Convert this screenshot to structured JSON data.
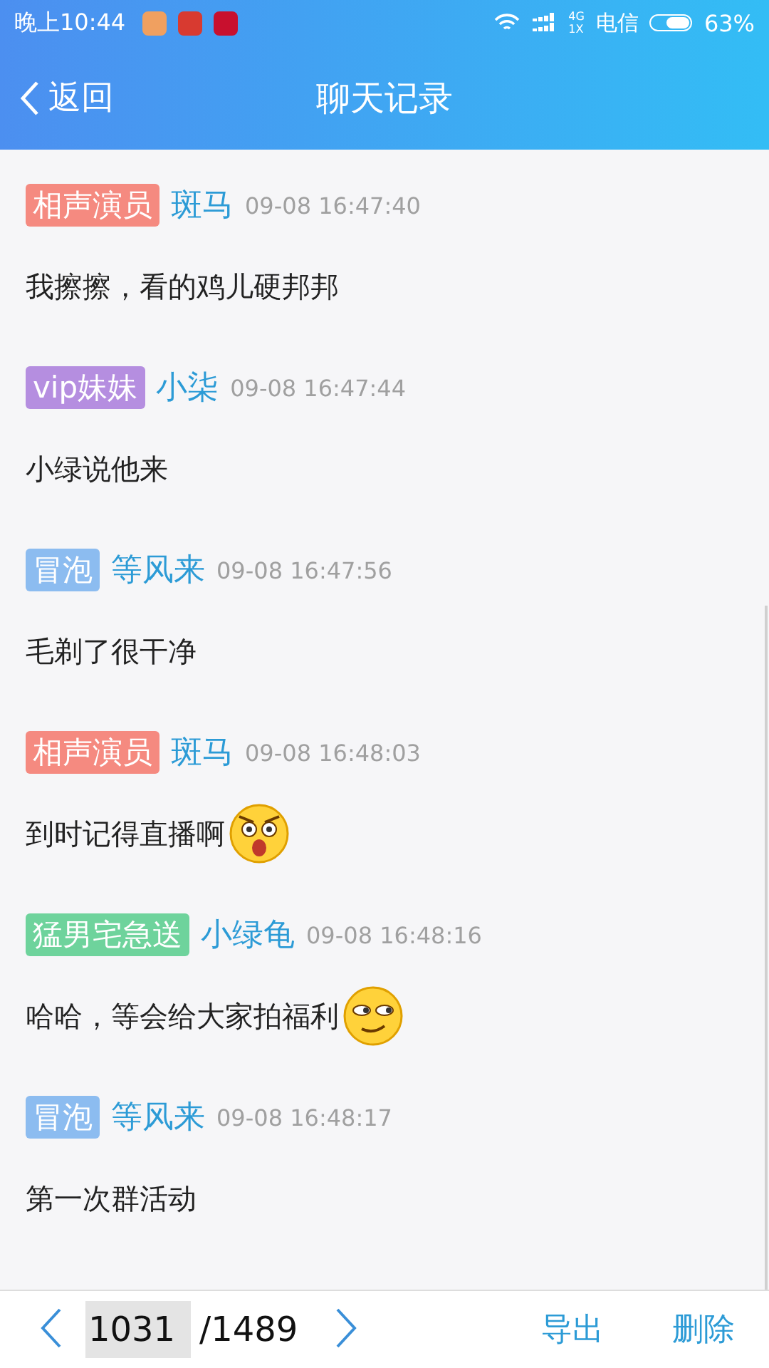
{
  "status_bar": {
    "time": "晚上10:44",
    "network": "4G",
    "network_sub": "1X",
    "carrier": "电信",
    "battery": "63%"
  },
  "header": {
    "back": "返回",
    "title": "聊天记录"
  },
  "messages": [
    {
      "kind": "text",
      "tag": "相声演员",
      "color": "#f58a80",
      "name": "斑马",
      "time": "09-08 16:47:40",
      "text": "我擦擦，看的鸡儿硬邦邦"
    },
    {
      "kind": "text",
      "tag": "vip妹妹",
      "color": "#b58ee0",
      "name": "小柒",
      "time": "09-08 16:47:44",
      "text": "小绿说他来"
    },
    {
      "kind": "text",
      "tag": "冒泡",
      "color": "#8cbcf0",
      "name": "等风来",
      "time": "09-08 16:47:56",
      "text": "毛剃了很干净"
    },
    {
      "kind": "surprised",
      "tag": "相声演员",
      "color": "#f58a80",
      "name": "斑马",
      "time": "09-08 16:48:03",
      "text": "到时记得直播啊"
    },
    {
      "kind": "smirk",
      "tag": "猛男宅急送",
      "color": "#6ed39c",
      "name": "小绿龟",
      "time": "09-08 16:48:16",
      "text": "哈哈，等会给大家拍福利"
    },
    {
      "kind": "text",
      "tag": "冒泡",
      "color": "#8cbcf0",
      "name": "等风来",
      "time": "09-08 16:48:17",
      "text": "第一次群活动"
    }
  ],
  "pager": {
    "page": "1031",
    "total": "/1489",
    "export": "导出",
    "delete": "删除"
  }
}
